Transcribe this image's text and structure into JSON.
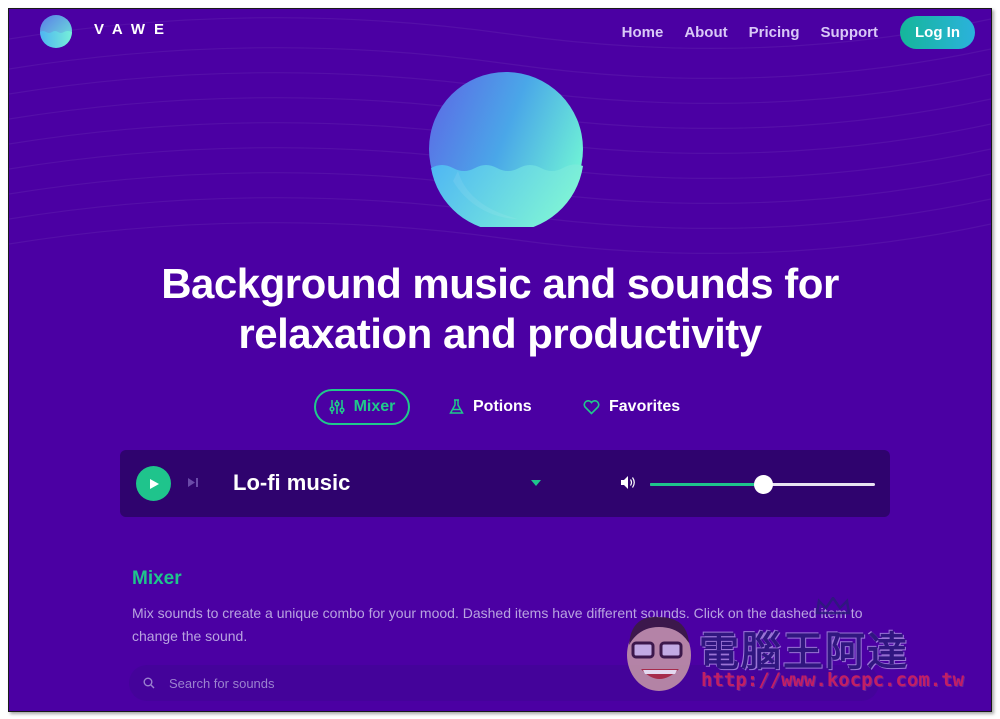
{
  "brand": {
    "name": "VAWE",
    "logo_icon": "wave-orb-logo"
  },
  "nav": {
    "items": [
      {
        "label": "Home"
      },
      {
        "label": "About"
      },
      {
        "label": "Pricing"
      },
      {
        "label": "Support"
      }
    ],
    "login_label": "Log In"
  },
  "hero": {
    "icon": "wave-orb",
    "headline_line1": "Background music and sounds for",
    "headline_line2": "relaxation and productivity"
  },
  "tabs": [
    {
      "label": "Mixer",
      "icon": "sliders-icon",
      "active": true
    },
    {
      "label": "Potions",
      "icon": "flask-icon",
      "active": false
    },
    {
      "label": "Favorites",
      "icon": "heart-icon",
      "active": false
    }
  ],
  "player": {
    "track": "Lo-fi music",
    "playing": false,
    "volume_percent": 50
  },
  "mixer": {
    "title": "Mixer",
    "description": "Mix sounds to create a unique combo for your mood. Dashed items have different sounds. Click on the dashed item to change the sound.",
    "search_placeholder": "Search for sounds",
    "search_value": ""
  },
  "watermark": {
    "chars": "電腦王阿達",
    "url": "http://www.kocpc.com.tw"
  },
  "colors": {
    "background": "#4b00a3",
    "accent": "#1fc48c",
    "player_bg": "#2f036e",
    "login_gradient_start": "#15b69a",
    "login_gradient_end": "#2bb2dc"
  }
}
